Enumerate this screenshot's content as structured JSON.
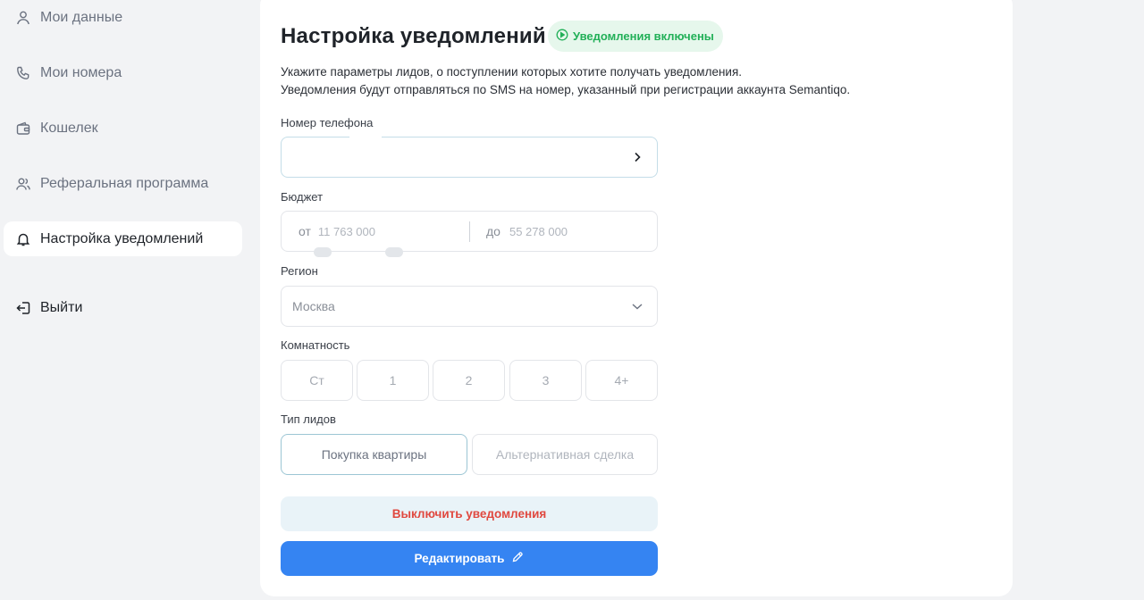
{
  "sidebar": {
    "items": [
      {
        "label": "Мои данные",
        "icon": "user-icon"
      },
      {
        "label": "Мои номера",
        "icon": "phone-icon"
      },
      {
        "label": "Кошелек",
        "icon": "wallet-icon"
      },
      {
        "label": "Реферальная программа",
        "icon": "users-icon"
      },
      {
        "label": "Настройка уведомлений",
        "icon": "bell-icon",
        "active": true
      }
    ],
    "logout_label": "Выйти"
  },
  "main": {
    "title": "Настройка уведомлений",
    "status_badge": "Уведомления включены",
    "description_line1": "Укажите параметры лидов, о поступлении которых хотите получать уведомления.",
    "description_line2": "Уведомления будут отправляться по SMS на номер, указанный при регистрации аккаунта Semantiqo.",
    "phone": {
      "label": "Номер телефона",
      "value": ""
    },
    "budget": {
      "label": "Бюджет",
      "from_prefix": "от",
      "from_value": "11 763 000",
      "to_prefix": "до",
      "to_value": "55 278 000"
    },
    "region": {
      "label": "Регион",
      "value": "Москва"
    },
    "rooms": {
      "label": "Комнатность",
      "options": [
        "Ст",
        "1",
        "2",
        "3",
        "4+"
      ]
    },
    "lead_type": {
      "label": "Тип лидов",
      "options": [
        "Покупка квартиры",
        "Альтернативная сделка"
      ],
      "selected": "Покупка квартиры"
    },
    "disable_button": "Выключить уведомления",
    "edit_button": "Редактировать"
  },
  "colors": {
    "accent": "#3584f2",
    "success": "#22b058",
    "danger": "#e0483f",
    "background": "#f2f3f5"
  }
}
